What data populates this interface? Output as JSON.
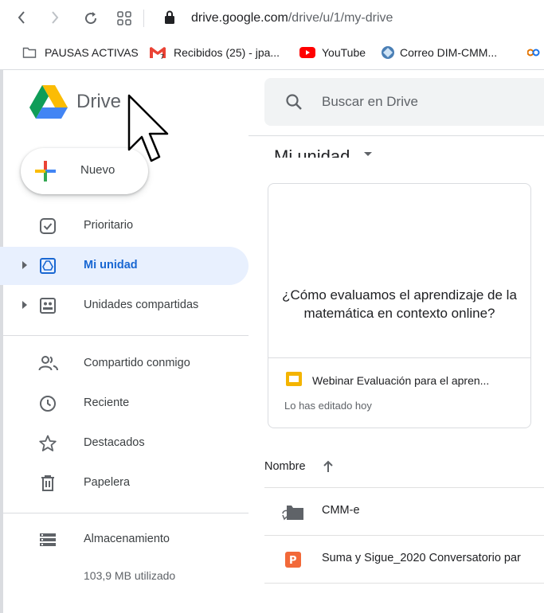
{
  "browser": {
    "url_host": "drive.google.com",
    "url_path": "/drive/u/1/my-drive",
    "bookmarks": [
      {
        "label": "PAUSAS ACTIVAS",
        "icon": "folder-icon"
      },
      {
        "label": "Recibidos (25) - jpa...",
        "icon": "gmail-icon"
      },
      {
        "label": "YouTube",
        "icon": "youtube-icon"
      },
      {
        "label": "Correo DIM-CMM...",
        "icon": "mail-globe-icon"
      }
    ]
  },
  "app": {
    "name": "Drive"
  },
  "search": {
    "placeholder": "Buscar en Drive"
  },
  "new_button": {
    "label": "Nuevo"
  },
  "sidebar": {
    "items": [
      {
        "label": "Prioritario",
        "icon": "priority-check-icon"
      },
      {
        "label": "Mi unidad",
        "icon": "my-drive-icon",
        "active": true
      },
      {
        "label": "Unidades compartidas",
        "icon": "shared-drives-icon"
      },
      {
        "label": "Compartido conmigo",
        "icon": "people-icon"
      },
      {
        "label": "Reciente",
        "icon": "clock-icon"
      },
      {
        "label": "Destacados",
        "icon": "star-icon"
      },
      {
        "label": "Papelera",
        "icon": "trash-icon"
      },
      {
        "label": "Almacenamiento",
        "icon": "storage-icon"
      }
    ],
    "storage_used": "103,9 MB utilizado"
  },
  "main": {
    "title": "Mi unidad",
    "card": {
      "preview_text": "¿Cómo evaluamos el aprendizaje de la matemática en contexto online?",
      "file_name": "Webinar Evaluación para el apren...",
      "subtitle": "Lo has editado hoy"
    },
    "sort_label": "Nombre",
    "files": [
      {
        "name": "CMM-e",
        "icon": "shared-folder-icon"
      },
      {
        "name": "Suma y Sigue_2020 Conversatorio par",
        "icon": "slides-p-icon"
      }
    ]
  },
  "colors": {
    "accent": "#1967d2",
    "active_bg": "#e8f0fe",
    "slides_yellow": "#f4b400",
    "ppt_orange": "#f26939"
  }
}
